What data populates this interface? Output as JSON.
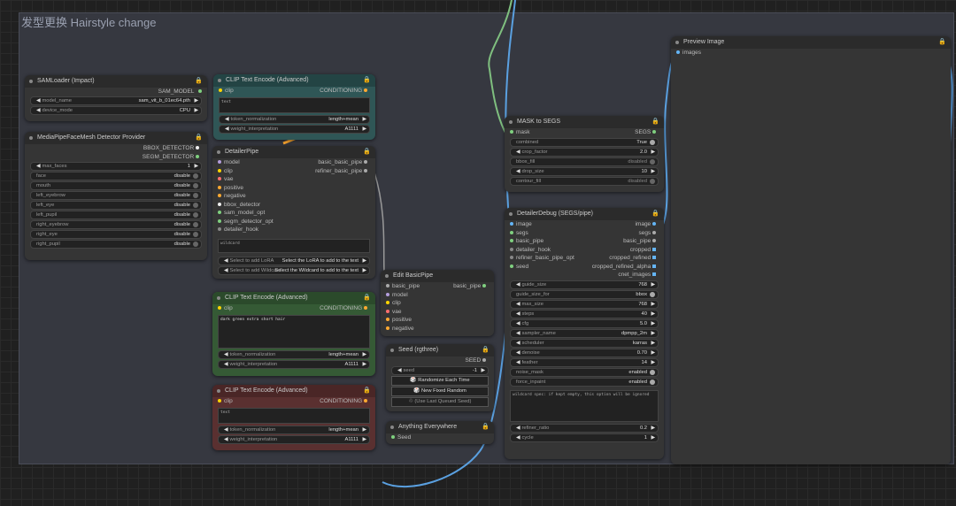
{
  "group": {
    "title": "发型更换 Hairstyle change"
  },
  "samloader": {
    "title": "SAMLoader (Impact)",
    "out": "SAM_MODEL",
    "widgets": [
      {
        "label": "model_name",
        "value": "sam_vit_b_01ec64.pth"
      },
      {
        "label": "device_mode",
        "value": "CPU"
      }
    ]
  },
  "mediapipe": {
    "title": "MediaPipeFaceMesh Detector Provider",
    "outs": [
      "BBOX_DETECTOR",
      "SEGM_DETECTOR"
    ],
    "max_faces": {
      "label": "max_faces",
      "value": "1"
    },
    "toggles": [
      {
        "label": "face",
        "value": "disable"
      },
      {
        "label": "mouth",
        "value": "disable"
      },
      {
        "label": "left_eyebrow",
        "value": "disable"
      },
      {
        "label": "left_eye",
        "value": "disable"
      },
      {
        "label": "left_pupil",
        "value": "disable"
      },
      {
        "label": "right_eyebrow",
        "value": "disable"
      },
      {
        "label": "right_eye",
        "value": "disable"
      },
      {
        "label": "right_pupil",
        "value": "disable"
      }
    ]
  },
  "clip1": {
    "title": "CLIP Text Encode (Advanced)",
    "in": "clip",
    "out": "CONDITIONING",
    "text": "text",
    "widgets": [
      {
        "label": "token_normalization",
        "value": "length+mean"
      },
      {
        "label": "weight_interpretation",
        "value": "A1111"
      }
    ]
  },
  "detailerpipe": {
    "title": "DetailerPipe",
    "inputs": [
      "model",
      "clip",
      "vae",
      "positive",
      "negative",
      "bbox_detector",
      "sam_model_opt",
      "segm_detector_opt",
      "detailer_hook"
    ],
    "outputs": [
      "basic_basic_pipe",
      "refiner_basic_pipe"
    ],
    "wildcard": "wildcard",
    "lora": {
      "label": "Select to add LoRA",
      "value": "Select the LoRA to add to the text"
    },
    "wild": {
      "label": "Select to add Wildcard",
      "value": "Select the Wildcard to add to the text"
    }
  },
  "clip2": {
    "title": "CLIP Text Encode (Advanced)",
    "in": "clip",
    "out": "CONDITIONING",
    "text": "dark green extra short hair",
    "widgets": [
      {
        "label": "token_normalization",
        "value": "length+mean"
      },
      {
        "label": "weight_interpretation",
        "value": "A1111"
      }
    ]
  },
  "clip3": {
    "title": "CLIP Text Encode (Advanced)",
    "in": "clip",
    "out": "CONDITIONING",
    "text": "text",
    "widgets": [
      {
        "label": "token_normalization",
        "value": "length+mean"
      },
      {
        "label": "weight_interpretation",
        "value": "A1111"
      }
    ]
  },
  "editpipe": {
    "title": "Edit BasicPipe",
    "inputs": [
      "basic_pipe",
      "model",
      "clip",
      "vae",
      "positive",
      "negative"
    ],
    "out": "basic_pipe"
  },
  "seed": {
    "title": "Seed (rgthree)",
    "out": "SEED",
    "seed": {
      "label": "seed",
      "value": "-1"
    },
    "buttons": [
      "🎲 Randomize Each Time",
      "🎲 New Fixed Random",
      "♲ (Use Last Queued Seed)"
    ]
  },
  "anything": {
    "title": "Anything Everywhere",
    "in": "Seed"
  },
  "masktosegs": {
    "title": "MASK to SEGS",
    "in": "mask",
    "out": "SEGS",
    "widgets": [
      {
        "label": "combined",
        "value": "True",
        "kind": "toggle"
      },
      {
        "label": "crop_factor",
        "value": "2.0",
        "kind": "num"
      },
      {
        "label": "bbox_fill",
        "value": "disabled",
        "kind": "toggle"
      },
      {
        "label": "drop_size",
        "value": "10",
        "kind": "num"
      },
      {
        "label": "contour_fill",
        "value": "disabled",
        "kind": "toggle"
      }
    ]
  },
  "detailerdebug": {
    "title": "DetailerDebug (SEGS/pipe)",
    "inputs": [
      "image",
      "segs",
      "basic_pipe",
      "detailer_hook",
      "refiner_basic_pipe_opt",
      "seed"
    ],
    "outputs": [
      "image",
      "segs",
      "basic_pipe",
      "cropped",
      "cropped_refined",
      "cropped_refined_alpha",
      "cnet_images"
    ],
    "widgets": [
      {
        "label": "guide_size",
        "value": "768",
        "kind": "num"
      },
      {
        "label": "guide_size_for",
        "value": "bbox",
        "kind": "toggle"
      },
      {
        "label": "max_size",
        "value": "768",
        "kind": "num"
      },
      {
        "label": "steps",
        "value": "40",
        "kind": "num"
      },
      {
        "label": "cfg",
        "value": "5.0",
        "kind": "num"
      },
      {
        "label": "sampler_name",
        "value": "dpmpp_2m",
        "kind": "num"
      },
      {
        "label": "scheduler",
        "value": "karras",
        "kind": "num"
      },
      {
        "label": "denoise",
        "value": "0.70",
        "kind": "num"
      },
      {
        "label": "feather",
        "value": "14",
        "kind": "num"
      },
      {
        "label": "noise_mask",
        "value": "enabled",
        "kind": "toggle"
      },
      {
        "label": "force_inpaint",
        "value": "enabled",
        "kind": "toggle"
      }
    ],
    "wildcard": "wildcard spec: if kept empty, this option will be ignored",
    "tail": [
      {
        "label": "refiner_ratio",
        "value": "0.2"
      },
      {
        "label": "cycle",
        "value": "1"
      }
    ]
  },
  "preview": {
    "title": "Preview Image",
    "in": "images"
  },
  "colors": {
    "clip": "#ffd500",
    "model": "#b39ddb",
    "vae": "#ff6e6e",
    "cond": "#ffa931",
    "image": "#64b5f6",
    "green": "#7fd07f"
  }
}
